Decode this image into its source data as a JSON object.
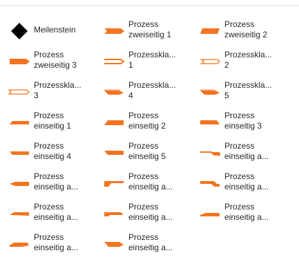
{
  "shapes": [
    {
      "label": "Meilenstein",
      "icon": "milestone-diamond-icon"
    },
    {
      "label": "Prozess\nzweiseitig 1",
      "icon": "process-two-sided-1-icon"
    },
    {
      "label": "Prozess\nzweiseitig 2",
      "icon": "process-two-sided-2-icon"
    },
    {
      "label": "Prozess\nzweiseitig 3",
      "icon": "process-two-sided-3-icon"
    },
    {
      "label": "Prozesskla...\n1",
      "icon": "process-bracket-1-icon"
    },
    {
      "label": "Prozesskla...\n2",
      "icon": "process-bracket-2-icon"
    },
    {
      "label": "Prozesskla...\n3",
      "icon": "process-bracket-3-icon"
    },
    {
      "label": "Prozesskla...\n4",
      "icon": "process-bracket-4-icon"
    },
    {
      "label": "Prozesskla...\n5",
      "icon": "process-bracket-5-icon"
    },
    {
      "label": "Prozess\neinseitig 1",
      "icon": "process-one-sided-1-icon"
    },
    {
      "label": "Prozess\neinseitig 2",
      "icon": "process-one-sided-2-icon"
    },
    {
      "label": "Prozess\neinseitig 3",
      "icon": "process-one-sided-3-icon"
    },
    {
      "label": "Prozess\neinseitig 4",
      "icon": "process-one-sided-4-icon"
    },
    {
      "label": "Prozess\neinseitig 5",
      "icon": "process-one-sided-5-icon"
    },
    {
      "label": "Prozess\neinseitig a...",
      "icon": "process-one-sided-a-icon"
    },
    {
      "label": "Prozess\neinseitig a...",
      "icon": "process-one-sided-a-icon"
    },
    {
      "label": "Prozess\neinseitig a...",
      "icon": "process-one-sided-a-icon"
    },
    {
      "label": "Prozess\neinseitig a...",
      "icon": "process-one-sided-a-icon"
    },
    {
      "label": "Prozess\neinseitig a...",
      "icon": "process-one-sided-a-icon"
    },
    {
      "label": "Prozess\neinseitig a...",
      "icon": "process-one-sided-a-icon"
    },
    {
      "label": "Prozess\neinseitig a...",
      "icon": "process-one-sided-a-icon"
    },
    {
      "label": "Prozess\neinseitig a...",
      "icon": "process-one-sided-a-icon"
    },
    {
      "label": "Prozess\neinseitig a...",
      "icon": "process-one-sided-a-icon"
    }
  ],
  "colors": {
    "accent": "#f5731f",
    "milestone": "#000000",
    "text": "#262626"
  }
}
